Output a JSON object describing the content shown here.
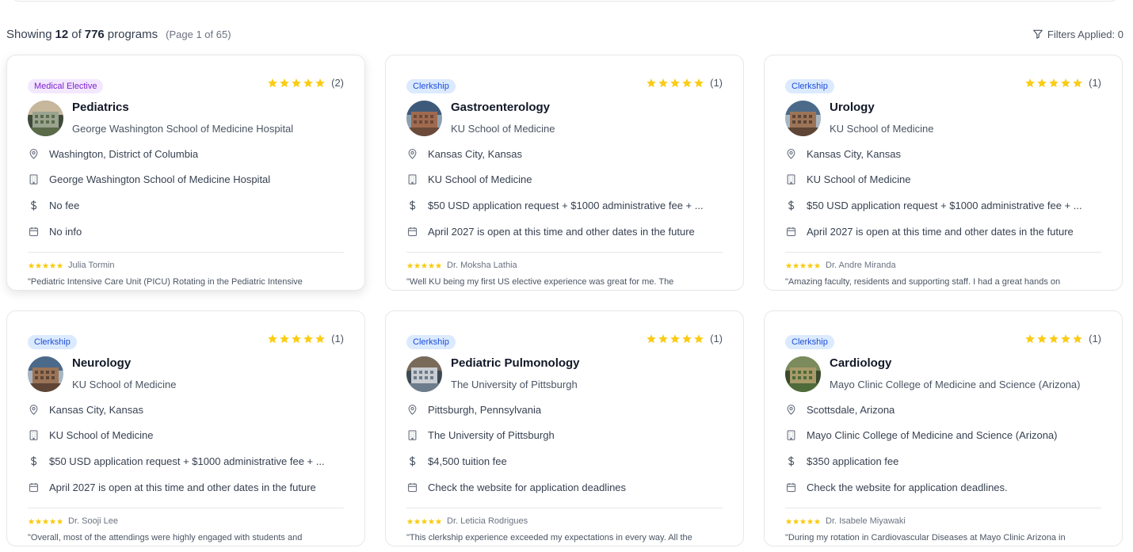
{
  "results": {
    "showing_label": "Showing",
    "shown": "12",
    "of_label": "of",
    "total": "776",
    "programs_label": "programs",
    "page_info": "(Page 1 of 65)",
    "filters_label": "Filters Applied: 0"
  },
  "colors": {
    "star": "#facc15",
    "elective_badge_bg": "#f3e8ff",
    "elective_badge_text": "#7e22ce",
    "clerkship_badge_bg": "#dbeafe",
    "clerkship_badge_text": "#1d4ed8"
  },
  "icons": {
    "location": "map-pin-icon",
    "institution": "building-icon",
    "fee": "dollar-icon",
    "dates": "calendar-icon",
    "filter": "filter-icon",
    "star": "star-icon"
  },
  "cards": [
    {
      "badge": "Medical Elective",
      "rating_count": "(2)",
      "title": "Pediatrics",
      "school": "George Washington School of Medicine Hospital",
      "location": "Washington, District of Columbia",
      "institution": "George Washington School of Medicine Hospital",
      "fee": "No fee",
      "dates": "No info",
      "reviewer": "Julia Tormin",
      "review": "\"Pediatric Intensive Care Unit (PICU) Rotating in the Pediatric Intensive"
    },
    {
      "badge": "Clerkship",
      "rating_count": "(1)",
      "title": "Gastroenterology",
      "school": "KU School of Medicine",
      "location": "Kansas City, Kansas",
      "institution": "KU School of Medicine",
      "fee": "$50 USD application request + $1000 administrative fee + ...",
      "dates": "April 2027 is open at this time and other dates in the future",
      "reviewer": "Dr. Moksha Lathia",
      "review": "\"Well KU being my first US elective experience was great for me. The"
    },
    {
      "badge": "Clerkship",
      "rating_count": "(1)",
      "title": "Urology",
      "school": "KU School of Medicine",
      "location": "Kansas City, Kansas",
      "institution": "KU School of Medicine",
      "fee": "$50 USD application request + $1000 administrative fee + ...",
      "dates": "April 2027 is open at this time and other dates in the future",
      "reviewer": "Dr. Andre Miranda",
      "review": "\"Amazing faculty, residents and supporting staff. I had a great hands on"
    },
    {
      "badge": "Clerkship",
      "rating_count": "(1)",
      "title": "Neurology",
      "school": "KU School of Medicine",
      "location": "Kansas City, Kansas",
      "institution": "KU School of Medicine",
      "fee": "$50 USD application request + $1000 administrative fee + ...",
      "dates": "April 2027 is open at this time and other dates in the future",
      "reviewer": "Dr. Sooji Lee",
      "review": "\"Overall, most of the attendings were highly engaged with students and"
    },
    {
      "badge": "Clerkship",
      "rating_count": "(1)",
      "title": "Pediatric Pulmonology",
      "school": "The University of Pittsburgh",
      "location": "Pittsburgh, Pennsylvania",
      "institution": "The University of Pittsburgh",
      "fee": "$4,500 tuition fee",
      "dates": "Check the website for application deadlines",
      "reviewer": "Dr. Leticia Rodrigues",
      "review": "\"This clerkship experience exceeded my expectations in every way. All the"
    },
    {
      "badge": "Clerkship",
      "rating_count": "(1)",
      "title": "Cardiology",
      "school": "Mayo Clinic College of Medicine and Science (Arizona)",
      "location": "Scottsdale, Arizona",
      "institution": "Mayo Clinic College of Medicine and Science (Arizona)",
      "fee": "$350 application fee",
      "dates": "Check the website for application deadlines.",
      "reviewer": "Dr. Isabele Miyawaki",
      "review": "\"During my rotation in Cardiovascular Diseases at Mayo Clinic Arizona in"
    }
  ]
}
